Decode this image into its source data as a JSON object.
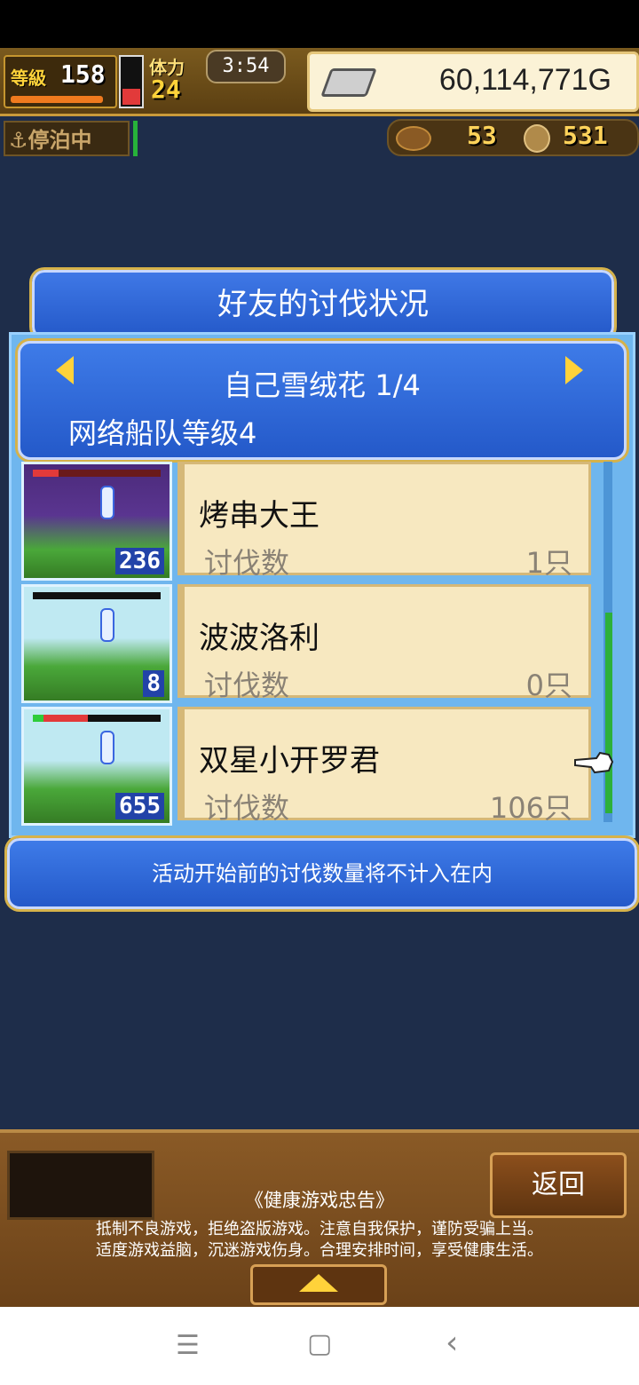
{
  "hud": {
    "level_label": "等級",
    "level": "158",
    "stamina_label": "体力",
    "stamina": "24",
    "timer": "3:54",
    "gold": "60,114,771G",
    "anchor_status": "停泊中",
    "resource1": "53",
    "resource2": "531"
  },
  "dialog": {
    "title": "好友的讨伐状况",
    "friend_name": "自己雪绒花 1/4",
    "fleet_level": "网络船队等级4",
    "kill_label": "讨伐数",
    "notice": "活动开始前的讨伐数量将不计入在内",
    "entries": [
      {
        "name": "烤串大王",
        "count": "1只",
        "thumb_number": "236"
      },
      {
        "name": "波波洛利",
        "count": "0只",
        "thumb_number": "8"
      },
      {
        "name": "双星小开罗君",
        "count": "106只",
        "thumb_number": "655"
      }
    ]
  },
  "footer": {
    "back_label": "返回",
    "advisory_title": "《健康游戏忠告》",
    "advisory_line1": "抵制不良游戏，拒绝盗版游戏。注意自我保护，谨防受骗上当。",
    "advisory_line2": "适度游戏益脑，沉迷游戏伤身。合理安排时间，享受健康生活。"
  },
  "nav": {
    "menu": "☰",
    "home": "▢",
    "back": "‹"
  },
  "colors": {
    "panel_blue": "#2459c9",
    "card_bg": "#f7e8c0",
    "gold_text": "#ffd33a"
  }
}
